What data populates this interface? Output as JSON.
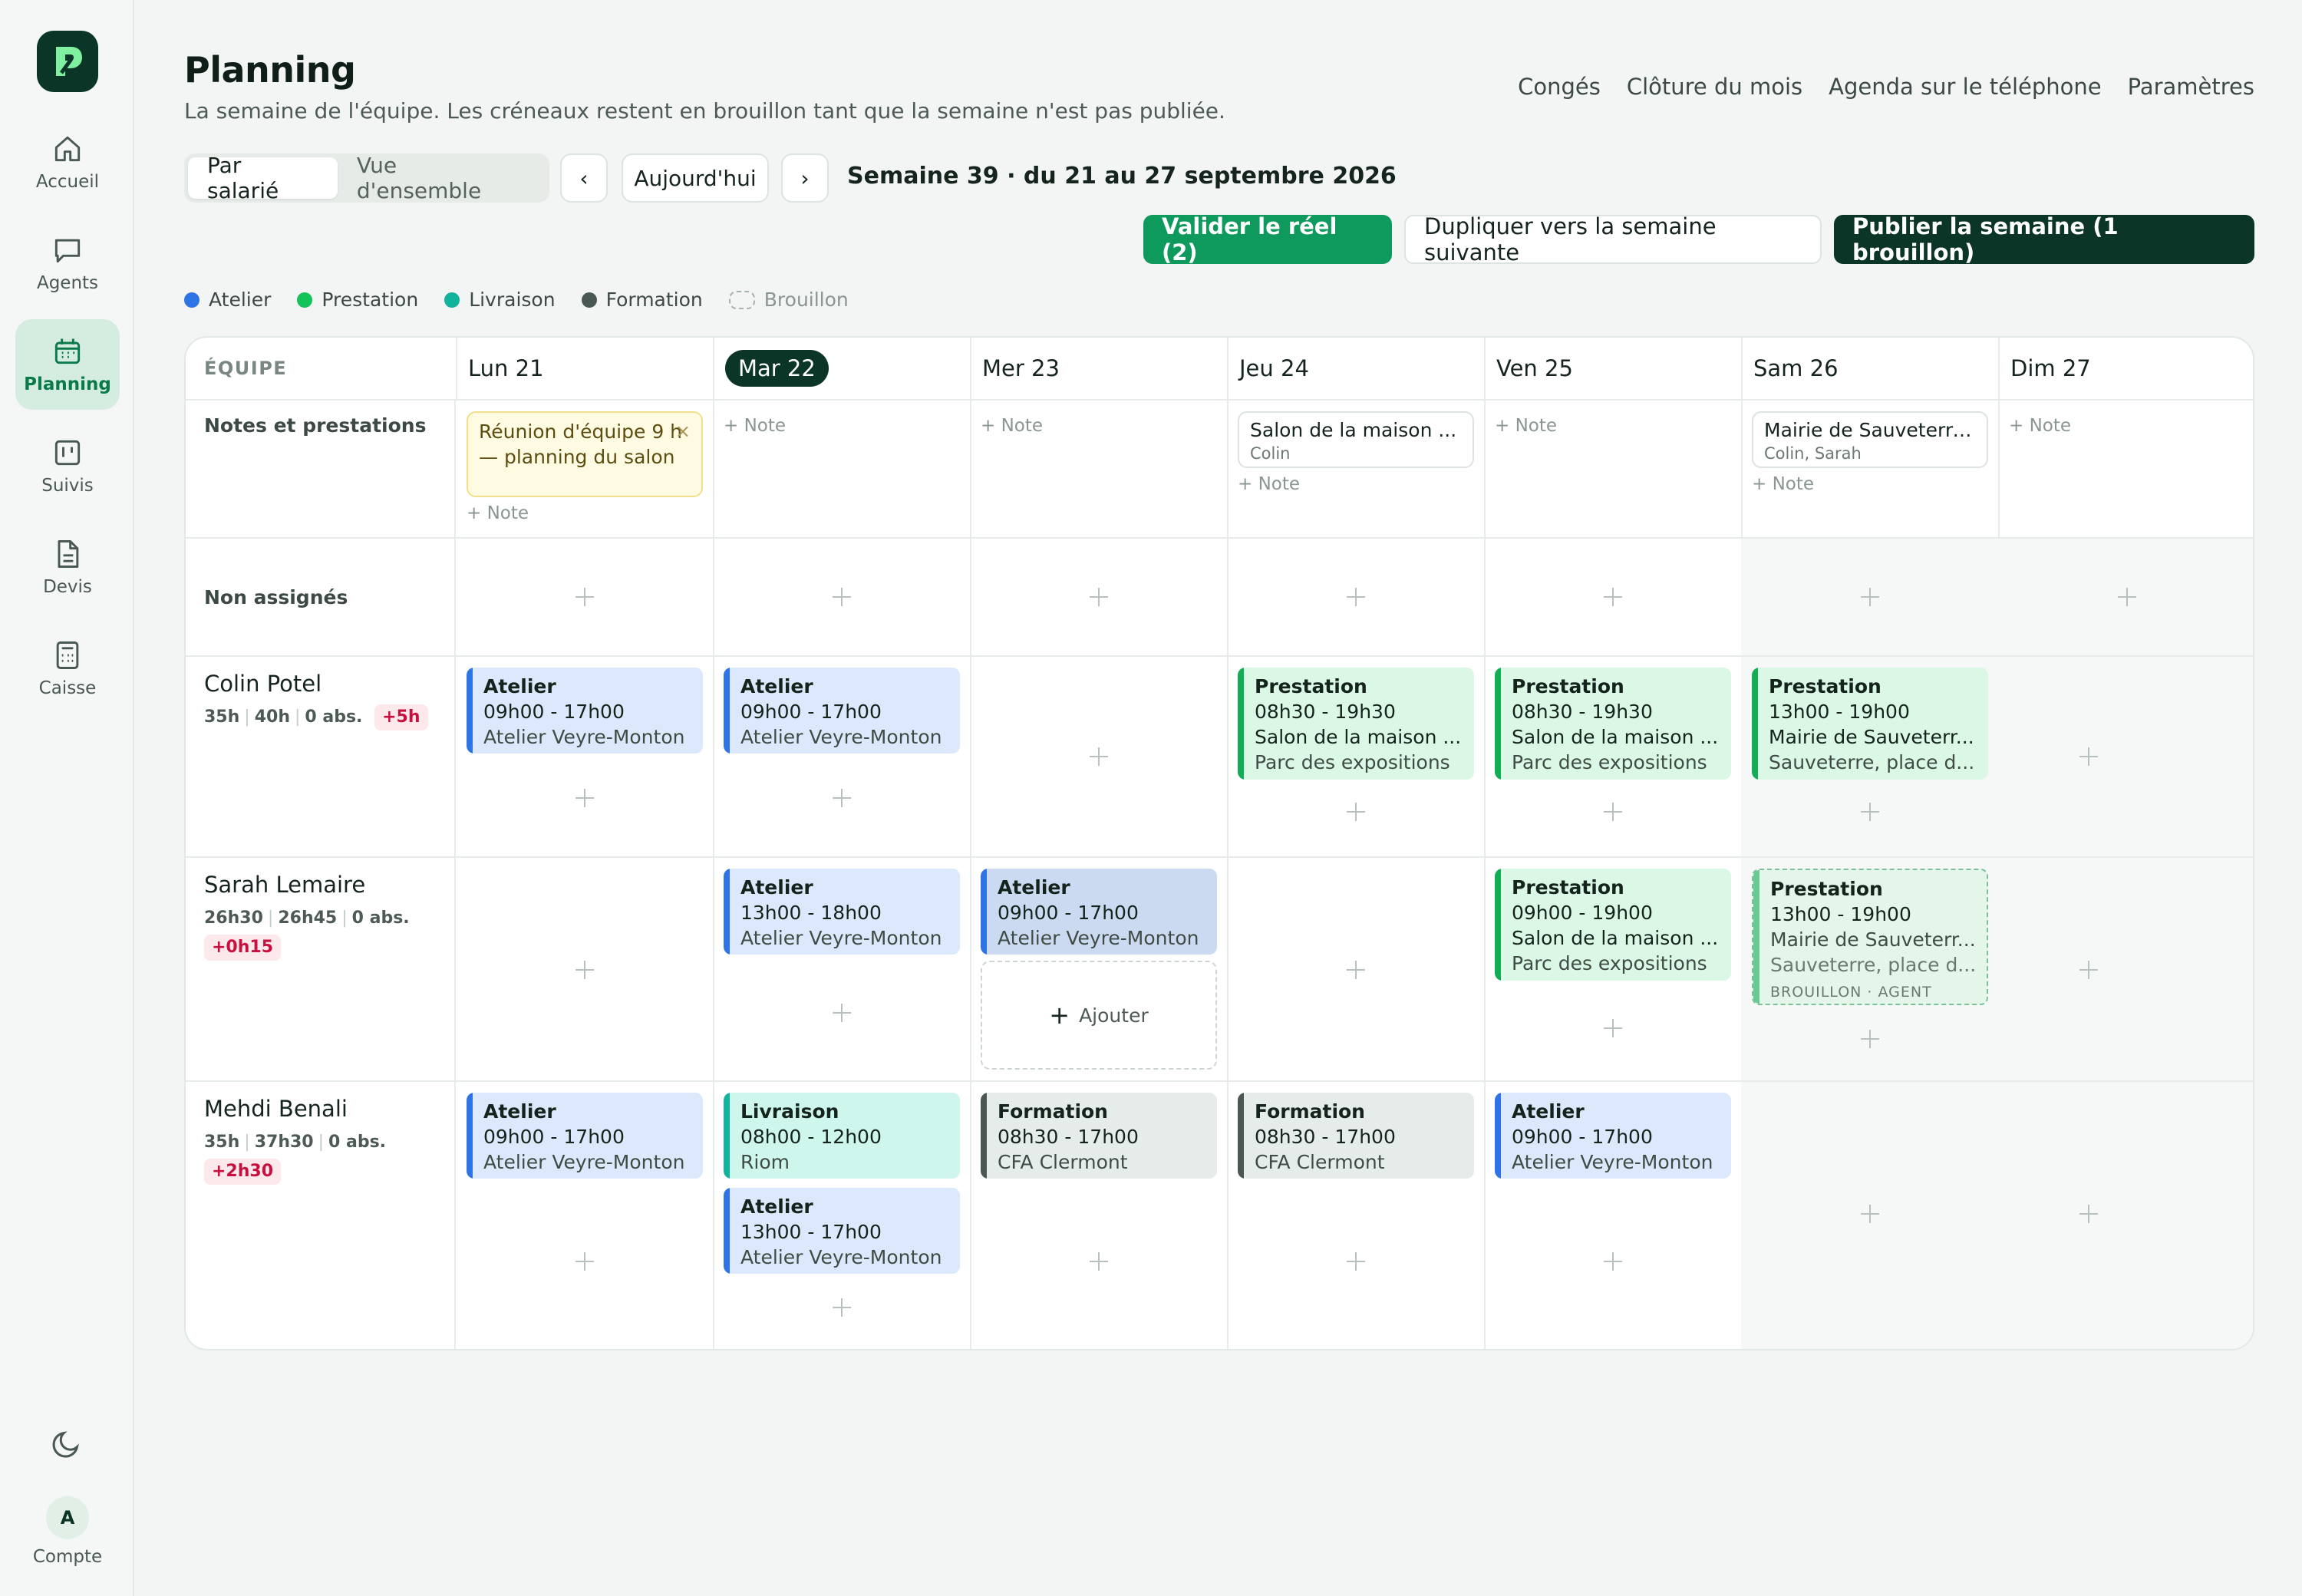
{
  "sidebar": {
    "items": [
      {
        "label": "Accueil"
      },
      {
        "label": "Agents"
      },
      {
        "label": "Planning"
      },
      {
        "label": "Suivis"
      },
      {
        "label": "Devis"
      },
      {
        "label": "Caisse"
      }
    ],
    "account": {
      "initial": "A",
      "label": "Compte"
    }
  },
  "header": {
    "title": "Planning",
    "subtitle": "La semaine de l'équipe. Les créneaux restent en brouillon tant que la semaine n'est pas publiée.",
    "links": [
      "Congés",
      "Clôture du mois",
      "Agenda sur le téléphone",
      "Paramètres"
    ]
  },
  "toolbar": {
    "view_by_employee": "Par salarié",
    "view_overview": "Vue d'ensemble",
    "prev": "‹",
    "today": "Aujourd'hui",
    "next": "›",
    "week_label": "Semaine 39 · du 21 au 27 septembre 2026",
    "validate": "Valider le réel (2)",
    "duplicate": "Dupliquer vers la semaine suivante",
    "publish": "Publier la semaine (1 brouillon)"
  },
  "legend": [
    {
      "label": "Atelier",
      "color": "#2f74e6"
    },
    {
      "label": "Prestation",
      "color": "#13c35a"
    },
    {
      "label": "Livraison",
      "color": "#12b39c"
    },
    {
      "label": "Formation",
      "color": "#4b5852"
    },
    {
      "label": "Brouillon",
      "color": "#a8b2ad"
    }
  ],
  "grid": {
    "team_header": "ÉQUIPE",
    "days": [
      "Lun 21",
      "Mar 22",
      "Mer 23",
      "Jeu 24",
      "Ven 25",
      "Sam 26",
      "Dim 27"
    ],
    "notes_label": "Notes et prestations",
    "unassigned_label": "Non assignés",
    "note_link": "+ Note",
    "add_label": "Ajouter",
    "notes": {
      "mon": "Réunion d'équipe 9 h — planning du salon",
      "thu_title": "Salon de la maison ...",
      "thu_sub": "Colin",
      "sat_title": "Mairie de Sauveterre...",
      "sat_sub": "Colin, Sarah"
    },
    "employees": [
      {
        "name": "Colin Potel",
        "planned": "35h",
        "contract": "40h",
        "absences": "0 abs.",
        "delta": "+5h"
      },
      {
        "name": "Sarah Lemaire",
        "planned": "26h30",
        "contract": "26h45",
        "absences": "0 abs.",
        "delta": "+0h15"
      },
      {
        "name": "Mehdi Benali",
        "planned": "35h",
        "contract": "37h30",
        "absences": "0 abs.",
        "delta": "+2h30"
      }
    ],
    "shifts": {
      "c_mon": {
        "kind": "Atelier",
        "hours": "09h00 - 17h00",
        "loc": "Atelier Veyre-Monton"
      },
      "c_tue": {
        "kind": "Atelier",
        "hours": "09h00 - 17h00",
        "loc": "Atelier Veyre-Monton"
      },
      "c_thu": {
        "kind": "Prestation",
        "hours": "08h30 - 19h30",
        "loc": "Salon de la maison ...",
        "loc2": "Parc des expositions"
      },
      "c_fri": {
        "kind": "Prestation",
        "hours": "08h30 - 19h30",
        "loc": "Salon de la maison ...",
        "loc2": "Parc des expositions"
      },
      "c_sat": {
        "kind": "Prestation",
        "hours": "13h00 - 19h00",
        "loc": "Mairie de Sauveterr...",
        "loc2": "Sauveterre, place d..."
      },
      "s_tue": {
        "kind": "Atelier",
        "hours": "13h00 - 18h00",
        "loc": "Atelier Veyre-Monton"
      },
      "s_wed": {
        "kind": "Atelier",
        "hours": "09h00 - 17h00",
        "loc": "Atelier Veyre-Monton"
      },
      "s_fri": {
        "kind": "Prestation",
        "hours": "09h00 - 19h00",
        "loc": "Salon de la maison ...",
        "loc2": "Parc des expositions"
      },
      "s_sat": {
        "kind": "Prestation",
        "hours": "13h00 - 19h00",
        "loc": "Mairie de Sauveterr...",
        "loc2": "Sauveterre, place d...",
        "tag": "BROUILLON · AGENT"
      },
      "m_mon": {
        "kind": "Atelier",
        "hours": "09h00 - 17h00",
        "loc": "Atelier Veyre-Monton"
      },
      "m_tue1": {
        "kind": "Livraison",
        "hours": "08h00 - 12h00",
        "loc": "Riom"
      },
      "m_tue2": {
        "kind": "Atelier",
        "hours": "13h00 - 17h00",
        "loc": "Atelier Veyre-Monton"
      },
      "m_wed": {
        "kind": "Formation",
        "hours": "08h30 - 17h00",
        "loc": "CFA Clermont"
      },
      "m_thu": {
        "kind": "Formation",
        "hours": "08h30 - 17h00",
        "loc": "CFA Clermont"
      },
      "m_fri": {
        "kind": "Atelier",
        "hours": "09h00 - 17h00",
        "loc": "Atelier Veyre-Monton"
      }
    }
  }
}
